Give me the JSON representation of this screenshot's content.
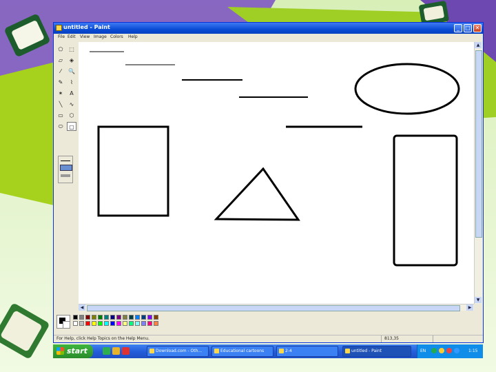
{
  "window": {
    "title": "untitled - Paint",
    "minimize": "_",
    "maximize": "□",
    "close": "✕"
  },
  "menu": [
    "File",
    "Edit",
    "View",
    "Image",
    "Colors",
    "Help"
  ],
  "tools": [
    {
      "icon": "free-select-icon",
      "glyph": "⬠"
    },
    {
      "icon": "rect-select-icon",
      "glyph": "⬚"
    },
    {
      "icon": "eraser-icon",
      "glyph": "▱"
    },
    {
      "icon": "fill-icon",
      "glyph": "◈"
    },
    {
      "icon": "color-picker-icon",
      "glyph": "⁄"
    },
    {
      "icon": "magnifier-icon",
      "glyph": "🔍"
    },
    {
      "icon": "pencil-icon",
      "glyph": "✎"
    },
    {
      "icon": "brush-icon",
      "glyph": "⌇"
    },
    {
      "icon": "airbrush-icon",
      "glyph": "✶"
    },
    {
      "icon": "text-icon",
      "glyph": "A"
    },
    {
      "icon": "line-icon",
      "glyph": "╲"
    },
    {
      "icon": "curve-icon",
      "glyph": "∿"
    },
    {
      "icon": "rectangle-icon",
      "glyph": "▭"
    },
    {
      "icon": "polygon-icon",
      "glyph": "⬡"
    },
    {
      "icon": "ellipse-icon",
      "glyph": "⬭"
    },
    {
      "icon": "rounded-rect-icon",
      "glyph": "▢"
    }
  ],
  "colors": {
    "palette_top": [
      "#000000",
      "#808080",
      "#800000",
      "#808000",
      "#008000",
      "#008080",
      "#000080",
      "#800080",
      "#808040",
      "#004040",
      "#0080ff",
      "#004080",
      "#8000ff",
      "#804000"
    ],
    "palette_bottom": [
      "#ffffff",
      "#c0c0c0",
      "#ff0000",
      "#ffff00",
      "#00ff00",
      "#00ffff",
      "#0000ff",
      "#ff00ff",
      "#ffff80",
      "#00ff80",
      "#80ffff",
      "#8080ff",
      "#ff0080",
      "#ff8040"
    ],
    "foreground": "#000000",
    "background": "#ffffff"
  },
  "status": {
    "help": "For Help, click Help Topics on the Help Menu.",
    "coords": "813,35"
  },
  "taskbar": {
    "start": "start",
    "tasks": [
      {
        "label": "Download.com - Oth...",
        "active": false
      },
      {
        "label": "Educational cartoons",
        "active": false
      },
      {
        "label": "2-4",
        "active": false
      },
      {
        "label": "untitled - Paint",
        "active": true
      }
    ],
    "tray_lang": "EN",
    "clock": "1:15"
  }
}
